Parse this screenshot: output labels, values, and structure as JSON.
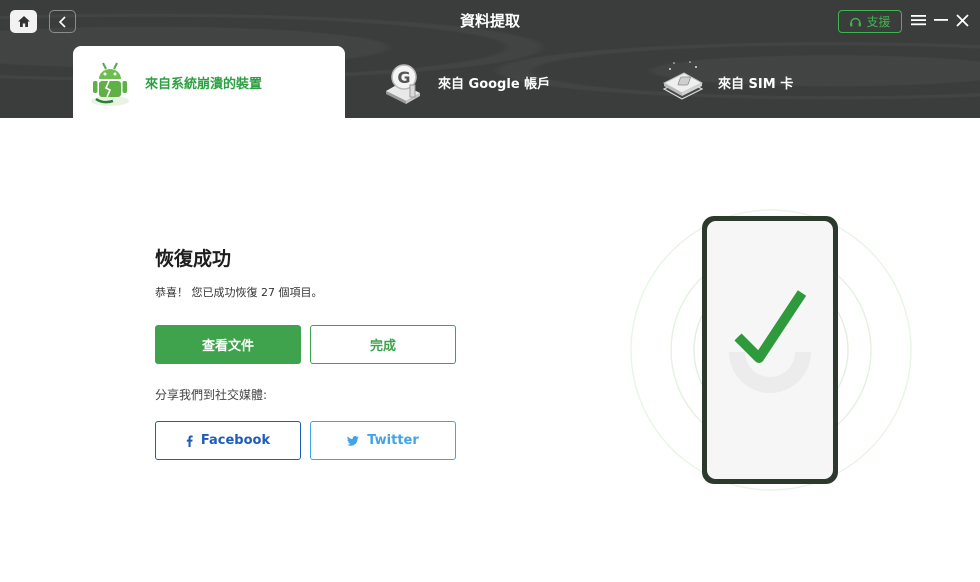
{
  "header": {
    "title": "資料提取",
    "support_label": "支援"
  },
  "tabs": [
    {
      "label": "來自系統崩潰的裝置",
      "active": true
    },
    {
      "label": "來自 Google 帳戶",
      "active": false
    },
    {
      "label": "來自 SIM 卡",
      "active": false
    }
  ],
  "result": {
    "title": "恢復成功",
    "message": "恭喜！ 您已成功恢復 27 個項目。",
    "view_button": "查看文件",
    "done_button": "完成",
    "share_label": "分享我們到社交媒體:",
    "facebook_button": "Facebook",
    "twitter_button": "Twitter"
  },
  "colors": {
    "header_bg": "#3a3d3c",
    "accent_green": "#3fa34d",
    "facebook_blue": "#1f5cb8",
    "twitter_blue": "#41a4e8"
  }
}
